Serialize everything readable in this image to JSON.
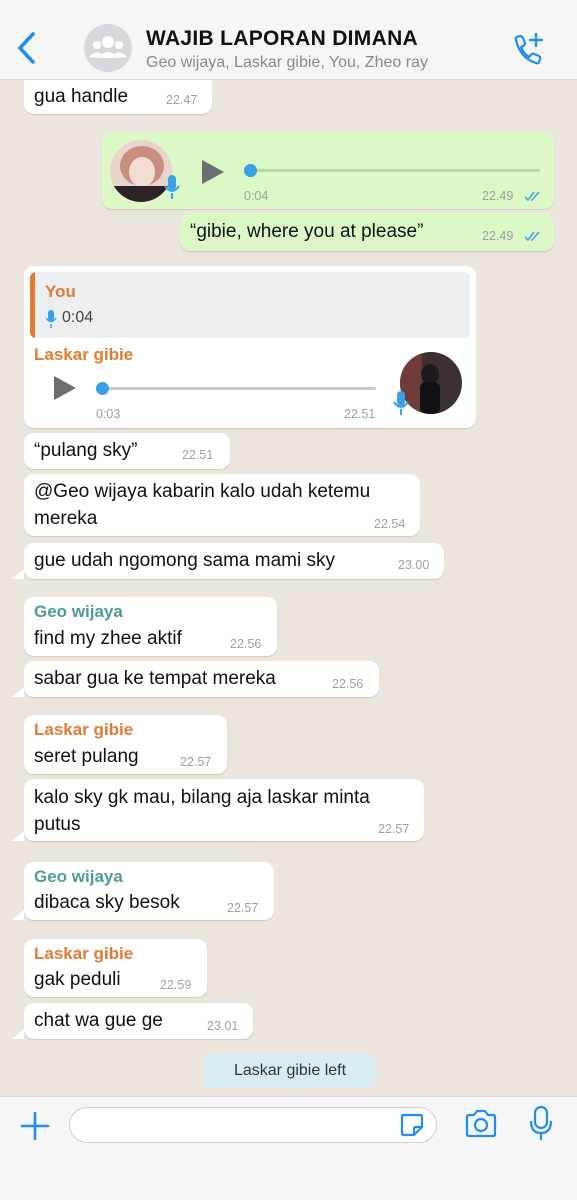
{
  "header": {
    "title": "WAJIB LAPORAN DIMANA",
    "members": "Geo wijaya, Laskar gibie, You, Zheo ray"
  },
  "colors": {
    "accent": "#1f8ef1",
    "outgoing_bubble": "#dcf8c6",
    "incoming_bubble": "#ffffff",
    "name_orange": "#e47b31",
    "name_teal": "#4e9c94",
    "read_ticks": "#4fa3e0",
    "play_dot": "#3aa0e8"
  },
  "messages": [
    {
      "type": "text",
      "direction": "in",
      "text": "gua handle",
      "time": "22.47"
    },
    {
      "type": "voice",
      "direction": "out",
      "duration": "0:04",
      "time": "22.49",
      "ticks": "read"
    },
    {
      "type": "text",
      "direction": "out",
      "text": "“gibie, where you at please”",
      "time": "22.49",
      "ticks": "read"
    },
    {
      "type": "voice_reply",
      "direction": "in",
      "sender": "Laskar gibie",
      "reply": {
        "author": "You",
        "duration": "0:04",
        "icon": "mic-icon"
      },
      "duration": "0:03",
      "time": "22.51"
    },
    {
      "type": "text",
      "direction": "in",
      "text": "“pulang sky”",
      "time": "22.51"
    },
    {
      "type": "text",
      "direction": "in",
      "text_lines": [
        "@Geo wijaya kabarin kalo udah ketemu",
        "mereka"
      ],
      "time": "22.54"
    },
    {
      "type": "text",
      "direction": "in",
      "text": "gue udah ngomong sama mami sky",
      "time": "23.00"
    },
    {
      "type": "text",
      "direction": "in",
      "sender": "Geo wijaya",
      "text": "find my zhee aktif",
      "time": "22.56"
    },
    {
      "type": "text",
      "direction": "in",
      "text": "sabar gua ke tempat mereka",
      "time": "22.56"
    },
    {
      "type": "text",
      "direction": "in",
      "sender": "Laskar gibie",
      "text": "seret pulang",
      "time": "22.57"
    },
    {
      "type": "text",
      "direction": "in",
      "text_lines": [
        "kalo sky gk mau, bilang aja laskar minta",
        "putus"
      ],
      "time": "22.57"
    },
    {
      "type": "text",
      "direction": "in",
      "sender": "Geo wijaya",
      "text": "dibaca sky besok",
      "time": "22.57"
    },
    {
      "type": "text",
      "direction": "in",
      "sender": "Laskar gibie",
      "text": "gak peduli",
      "time": "22.59"
    },
    {
      "type": "text",
      "direction": "in",
      "text": "chat wa gue ge",
      "time": "23.01"
    }
  ],
  "system_message": "Laskar gibie left",
  "composer": {
    "value": "",
    "icons": [
      "plus-icon",
      "sticker-icon",
      "camera-icon",
      "microphone-icon"
    ]
  }
}
